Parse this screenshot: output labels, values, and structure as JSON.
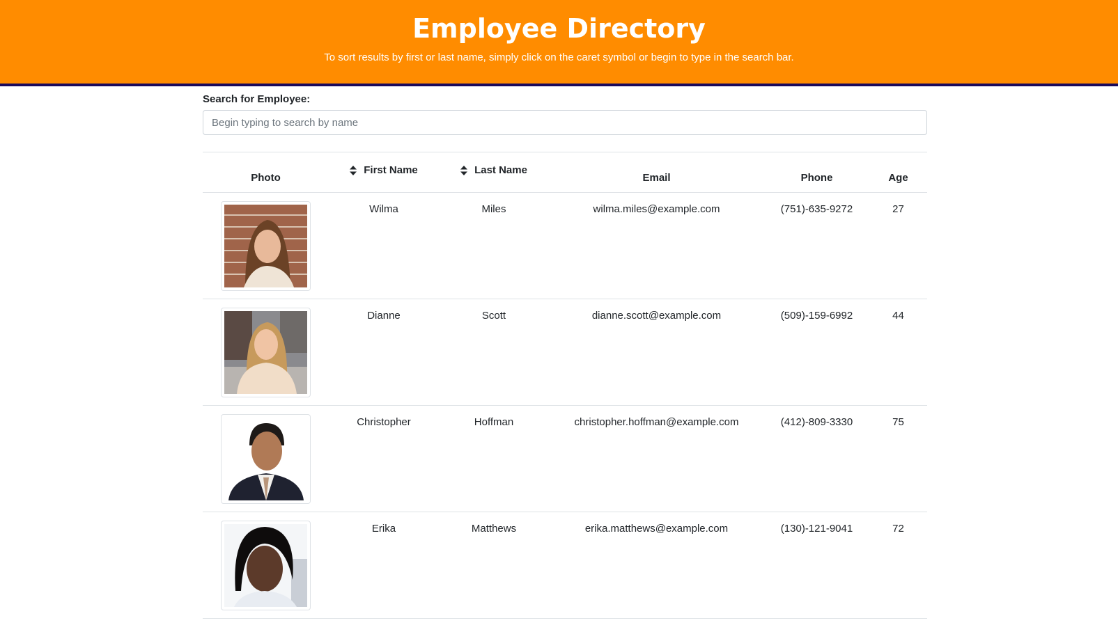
{
  "header": {
    "title": "Employee Directory",
    "subtitle": "To sort results by first or last name, simply click on the caret symbol or begin to type in the search bar."
  },
  "search": {
    "label": "Search for Employee:",
    "placeholder": "Begin typing to search by name",
    "value": ""
  },
  "table": {
    "columns": {
      "photo": "Photo",
      "first_name": "First Name",
      "last_name": "Last Name",
      "email": "Email",
      "phone": "Phone",
      "age": "Age"
    },
    "rows": [
      {
        "first": "Wilma",
        "last": "Miles",
        "email": "wilma.miles@example.com",
        "phone": "(751)-635-9272",
        "age": "27"
      },
      {
        "first": "Dianne",
        "last": "Scott",
        "email": "dianne.scott@example.com",
        "phone": "(509)-159-6992",
        "age": "44"
      },
      {
        "first": "Christopher",
        "last": "Hoffman",
        "email": "christopher.hoffman@example.com",
        "phone": "(412)-809-3330",
        "age": "75"
      },
      {
        "first": "Erika",
        "last": "Matthews",
        "email": "erika.matthews@example.com",
        "phone": "(130)-121-9041",
        "age": "72"
      }
    ]
  },
  "colors": {
    "header_bg": "#ff8c00",
    "header_border": "#1a0a5c"
  },
  "icons": {
    "sort": "sort-caret-icon"
  }
}
